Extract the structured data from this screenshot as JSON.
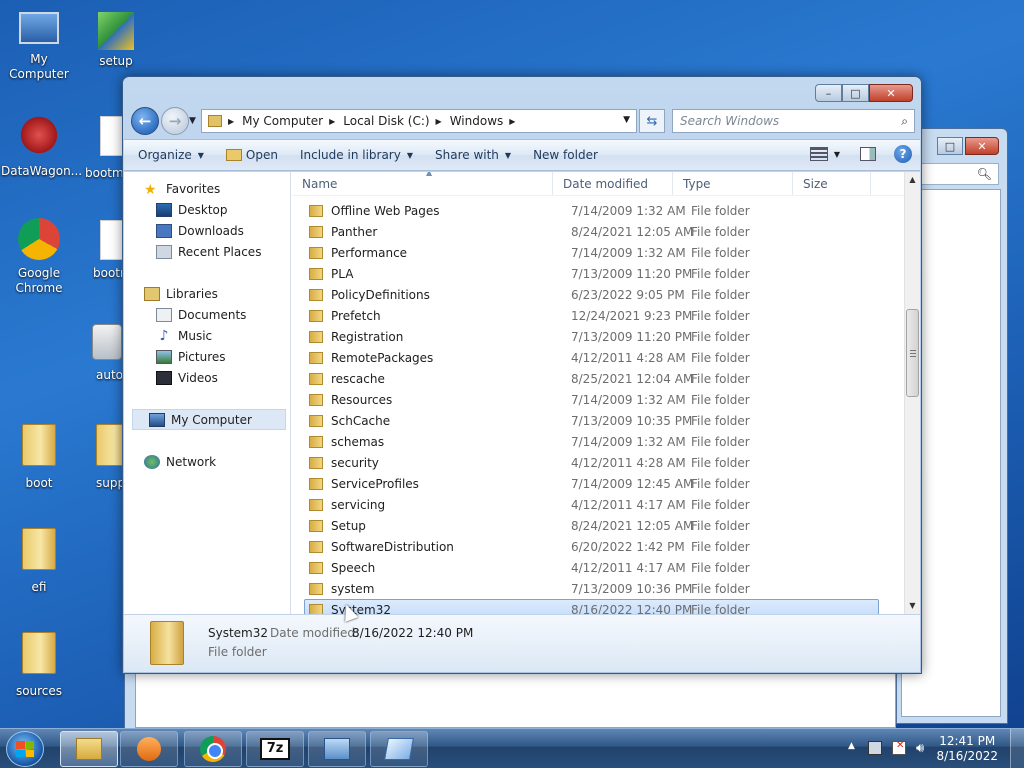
{
  "desktop": {
    "icons": [
      {
        "label": "My Computer",
        "icon": "computer-icon"
      },
      {
        "label": "setup",
        "icon": "setup-icon"
      },
      {
        "label": "DataWagon...",
        "icon": "network-graph-icon"
      },
      {
        "label": "bootm",
        "icon": "file-icon"
      },
      {
        "label": "Google Chrome",
        "icon": "chrome-icon"
      },
      {
        "label": "bootr",
        "icon": "file-icon"
      },
      {
        "label": "auto",
        "icon": "autorun-icon"
      },
      {
        "label": "boot",
        "icon": "folder-icon"
      },
      {
        "label": "supp",
        "icon": "folder-icon"
      },
      {
        "label": "efi",
        "icon": "folder-icon"
      },
      {
        "label": "sources",
        "icon": "folder-icon"
      }
    ]
  },
  "window": {
    "caption_buttons": {
      "minimize": "–",
      "maximize": "□",
      "close": "✕"
    },
    "breadcrumb": [
      "My Computer",
      "Local Disk (C:)",
      "Windows"
    ],
    "search_placeholder": "Search Windows",
    "toolbar": {
      "organize": "Organize",
      "open": "Open",
      "include_in_library": "Include in library",
      "share_with": "Share with",
      "new_folder": "New folder"
    },
    "nav": {
      "favorites": "Favorites",
      "desktop": "Desktop",
      "downloads": "Downloads",
      "recent_places": "Recent Places",
      "libraries": "Libraries",
      "documents": "Documents",
      "music": "Music",
      "pictures": "Pictures",
      "videos": "Videos",
      "my_computer": "My Computer",
      "network": "Network"
    },
    "columns": {
      "name": "Name",
      "date_modified": "Date modified",
      "type": "Type",
      "size": "Size"
    },
    "files": [
      {
        "name": "Offline Web Pages",
        "date": "7/14/2009 1:32 AM",
        "type": "File folder"
      },
      {
        "name": "Panther",
        "date": "8/24/2021 12:05 AM",
        "type": "File folder"
      },
      {
        "name": "Performance",
        "date": "7/14/2009 1:32 AM",
        "type": "File folder"
      },
      {
        "name": "PLA",
        "date": "7/13/2009 11:20 PM",
        "type": "File folder"
      },
      {
        "name": "PolicyDefinitions",
        "date": "6/23/2022 9:05 PM",
        "type": "File folder"
      },
      {
        "name": "Prefetch",
        "date": "12/24/2021 9:23 PM",
        "type": "File folder"
      },
      {
        "name": "Registration",
        "date": "7/13/2009 11:20 PM",
        "type": "File folder"
      },
      {
        "name": "RemotePackages",
        "date": "4/12/2011 4:28 AM",
        "type": "File folder"
      },
      {
        "name": "rescache",
        "date": "8/25/2021 12:04 AM",
        "type": "File folder"
      },
      {
        "name": "Resources",
        "date": "7/14/2009 1:32 AM",
        "type": "File folder"
      },
      {
        "name": "SchCache",
        "date": "7/13/2009 10:35 PM",
        "type": "File folder"
      },
      {
        "name": "schemas",
        "date": "7/14/2009 1:32 AM",
        "type": "File folder"
      },
      {
        "name": "security",
        "date": "4/12/2011 4:28 AM",
        "type": "File folder"
      },
      {
        "name": "ServiceProfiles",
        "date": "7/14/2009 12:45 AM",
        "type": "File folder"
      },
      {
        "name": "servicing",
        "date": "4/12/2011 4:17 AM",
        "type": "File folder"
      },
      {
        "name": "Setup",
        "date": "8/24/2021 12:05 AM",
        "type": "File folder"
      },
      {
        "name": "SoftwareDistribution",
        "date": "6/20/2022 1:42 PM",
        "type": "File folder"
      },
      {
        "name": "Speech",
        "date": "4/12/2011 4:17 AM",
        "type": "File folder"
      },
      {
        "name": "system",
        "date": "7/13/2009 10:36 PM",
        "type": "File folder"
      },
      {
        "name": "System32",
        "date": "8/16/2022 12:40 PM",
        "type": "File folder",
        "selected": true
      }
    ],
    "details": {
      "name": "System32",
      "date_label": "Date modified:",
      "date_value": "8/16/2022 12:40 PM",
      "type": "File folder"
    }
  },
  "taskbar": {
    "apps": [
      "explorer-icon",
      "media-player-icon",
      "chrome-icon",
      "7zip-icon",
      "control-panel-icon",
      "notepad-icon"
    ],
    "zip_text": "7z",
    "clock_time": "12:41 PM",
    "clock_date": "8/16/2022"
  }
}
